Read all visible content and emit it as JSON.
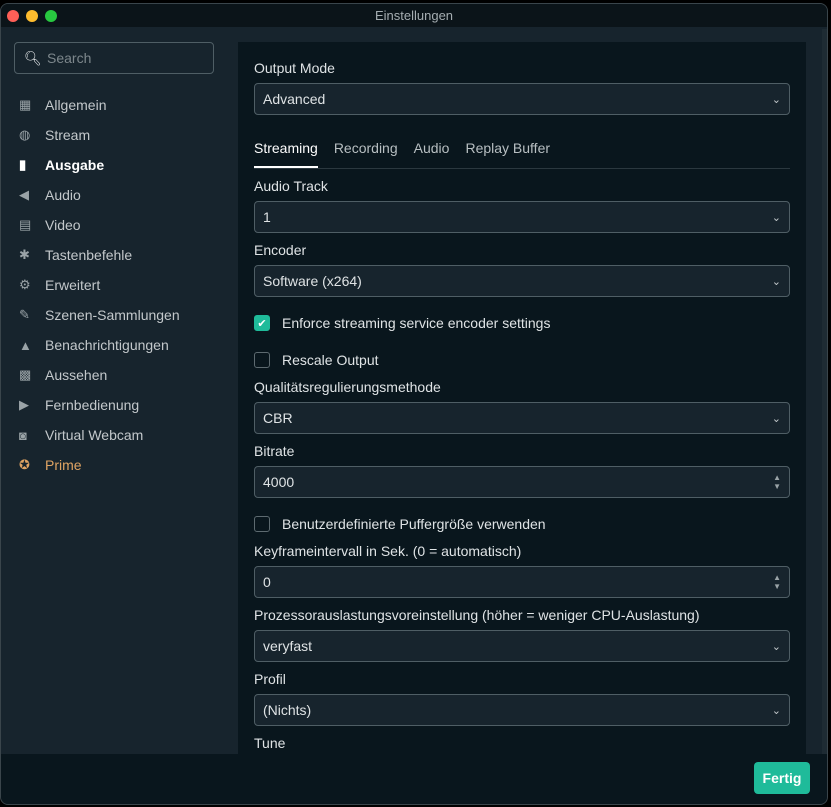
{
  "window": {
    "title": "Einstellungen"
  },
  "sidebar": {
    "search_placeholder": "Search",
    "items": [
      {
        "label": "Allgemein",
        "icon": "grid-icon",
        "glyph": "▦"
      },
      {
        "label": "Stream",
        "icon": "globe-icon",
        "glyph": "◍"
      },
      {
        "label": "Ausgabe",
        "icon": "chip-icon",
        "glyph": "▮",
        "active": true
      },
      {
        "label": "Audio",
        "icon": "speaker-icon",
        "glyph": "◀"
      },
      {
        "label": "Video",
        "icon": "film-icon",
        "glyph": "▤"
      },
      {
        "label": "Tastenbefehle",
        "icon": "gear-icon",
        "glyph": "✱"
      },
      {
        "label": "Erweitert",
        "icon": "gears-icon",
        "glyph": "⚙"
      },
      {
        "label": "Szenen-Sammlungen",
        "icon": "magic-wand-icon",
        "glyph": "✎"
      },
      {
        "label": "Benachrichtigungen",
        "icon": "bell-icon",
        "glyph": "▲"
      },
      {
        "label": "Aussehen",
        "icon": "shapes-icon",
        "glyph": "▩"
      },
      {
        "label": "Fernbedienung",
        "icon": "play-circle-icon",
        "glyph": "▶"
      },
      {
        "label": "Virtual Webcam",
        "icon": "camera-icon",
        "glyph": "◙"
      },
      {
        "label": "Prime",
        "icon": "prime-badge-icon",
        "glyph": "✪"
      }
    ]
  },
  "content": {
    "output_mode_label": "Output Mode",
    "output_mode_value": "Advanced",
    "tabs": [
      "Streaming",
      "Recording",
      "Audio",
      "Replay Buffer"
    ],
    "active_tab": "Streaming",
    "audio_track_label": "Audio Track",
    "audio_track_value": "1",
    "encoder_label": "Encoder",
    "encoder_value": "Software (x264)",
    "enforce_label": "Enforce streaming service encoder settings",
    "enforce_checked": true,
    "rescale_label": "Rescale Output",
    "rescale_checked": false,
    "rate_control_label": "Qualitätsregulierungsmethode",
    "rate_control_value": "CBR",
    "bitrate_label": "Bitrate",
    "bitrate_value": "4000",
    "buffer_label": "Benutzerdefinierte Puffergröße verwenden",
    "buffer_checked": false,
    "keyframe_label": "Keyframeintervall in Sek. (0 = automatisch)",
    "keyframe_value": "0",
    "preset_label": "Prozessorauslastungsvoreinstellung (höher = weniger CPU-Auslastung)",
    "preset_value": "veryfast",
    "profile_label": "Profil",
    "profile_value": "(Nichts)",
    "tune_label": "Tune"
  },
  "footer": {
    "done_label": "Fertig"
  },
  "colors": {
    "accent": "#1fbb9a",
    "prime": "#e0a463",
    "background": "#17242d",
    "panel": "#09161d"
  }
}
